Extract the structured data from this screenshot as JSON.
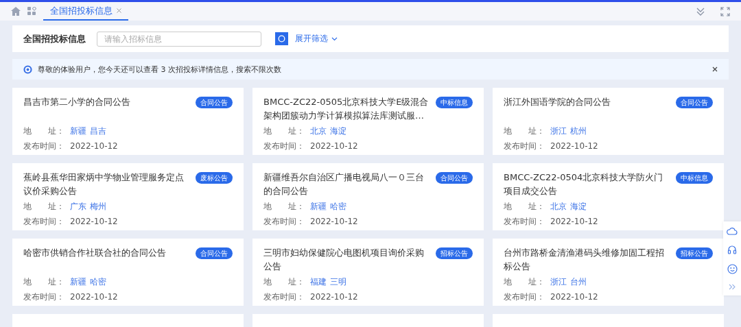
{
  "tabs": [
    {
      "label": "全国招投标信息",
      "selected": true
    }
  ],
  "header": {
    "title": "全国招投标信息",
    "search": {
      "placeholder": "请输入招标信息"
    },
    "filter_link": "展开筛选"
  },
  "notice": {
    "text": "尊敬的体验用户，您今天还可以查看 3 次招投标详情信息，搜索不限次数"
  },
  "cards": [
    {
      "title": "昌吉市第二小学的合同公告",
      "tag": "合同公告",
      "address_label": "地　　址：",
      "address": [
        "新疆",
        "昌吉"
      ],
      "date_label": "发布时间：",
      "date": "2022-10-12"
    },
    {
      "title": "BMCC-ZC22-0505北京科技大学E级混合架构团簇动力学计算模拟算法库测试服…",
      "tag": "中标信息",
      "address_label": "地　　址：",
      "address": [
        "北京",
        "海淀"
      ],
      "date_label": "发布时间：",
      "date": "2022-10-12"
    },
    {
      "title": "浙江外国语学院的合同公告",
      "tag": "合同公告",
      "address_label": "地　　址：",
      "address": [
        "浙江",
        "杭州"
      ],
      "date_label": "发布时间：",
      "date": "2022-10-12"
    },
    {
      "title": "蕉岭县蕉华田家炳中学物业管理服务定点议价采购公告",
      "tag": "废标公告",
      "address_label": "地　　址：",
      "address": [
        "广东",
        "梅州"
      ],
      "date_label": "发布时间：",
      "date": "2022-10-12"
    },
    {
      "title": "新疆维吾尔自治区广播电视局八一０三台的合同公告",
      "tag": "合同公告",
      "address_label": "地　　址：",
      "address": [
        "新疆",
        "哈密"
      ],
      "date_label": "发布时间：",
      "date": "2022-10-12"
    },
    {
      "title": "BMCC-ZC22-0504北京科技大学防火门项目成交公告",
      "tag": "中标信息",
      "address_label": "地　　址：",
      "address": [
        "北京",
        "海淀"
      ],
      "date_label": "发布时间：",
      "date": "2022-10-12"
    },
    {
      "title": "哈密市供销合作社联合社的合同公告",
      "tag": "合同公告",
      "address_label": "地　　址：",
      "address": [
        "新疆",
        "哈密"
      ],
      "date_label": "发布时间：",
      "date": "2022-10-12"
    },
    {
      "title": "三明市妇幼保健院心电图机项目询价采购公告",
      "tag": "招标公告",
      "address_label": "地　　址：",
      "address": [
        "福建",
        "三明"
      ],
      "date_label": "发布时间：",
      "date": "2022-10-12"
    },
    {
      "title": "台州市路桥金清渔港码头维修加固工程招标公告",
      "tag": "招标公告",
      "address_label": "地　　址：",
      "address": [
        "浙江",
        "台州"
      ],
      "date_label": "发布时间：",
      "date": "2022-10-12"
    }
  ]
}
